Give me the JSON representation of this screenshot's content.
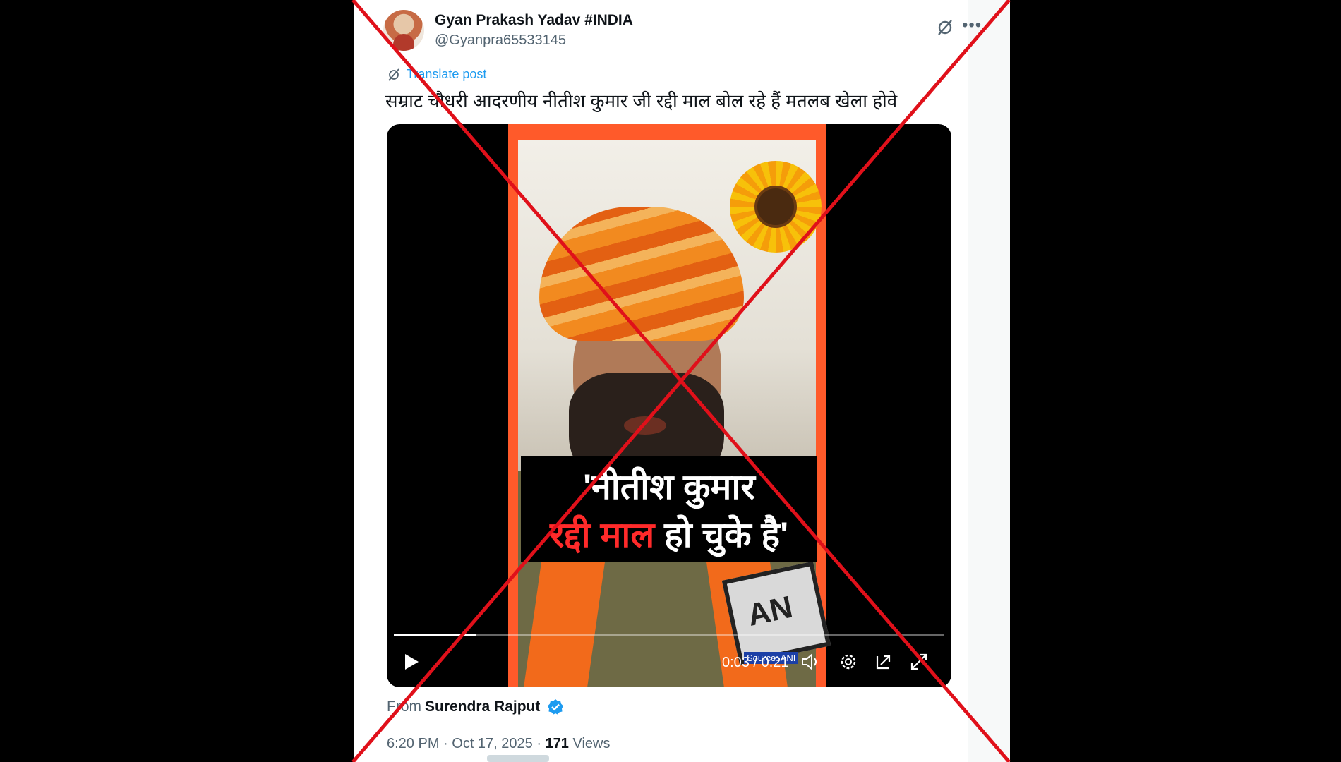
{
  "post": {
    "author_name": "Gyan Prakash Yadav #INDIA",
    "author_handle": "@Gyanpra65533145",
    "translate_label": "Translate post",
    "text": "सम्राट चौधरी आदरणीय नीतीश कुमार जी रद्दी माल बोल रहे हैं मतलब खेला होवे",
    "from_prefix": "From",
    "from_name": "Surendra Rajput",
    "timestamp": "6:20 PM · Oct 17, 2025 · ",
    "views_count": "171",
    "views_label": " Views"
  },
  "video": {
    "caption_line1": "'नीतीश कुमार",
    "caption_line2_red": "रद्दी माल",
    "caption_line2_white": " हो चुके है'",
    "mic_label": "AN",
    "source_tag": "Source: ANI",
    "time": "0:03 / 0:21",
    "progress": 0.15
  },
  "icons": {
    "grok": "grok-icon",
    "more": "more-icon",
    "translate": "translate-icon",
    "play": "play-icon",
    "volume": "volume-icon",
    "settings": "settings-icon",
    "pip": "picture-in-picture-icon",
    "fullscreen": "fullscreen-icon",
    "verified": "verified-badge-icon"
  },
  "colors": {
    "link": "#1d9bf0",
    "cross": "#e0101a",
    "frame": "#ff5a2a"
  }
}
